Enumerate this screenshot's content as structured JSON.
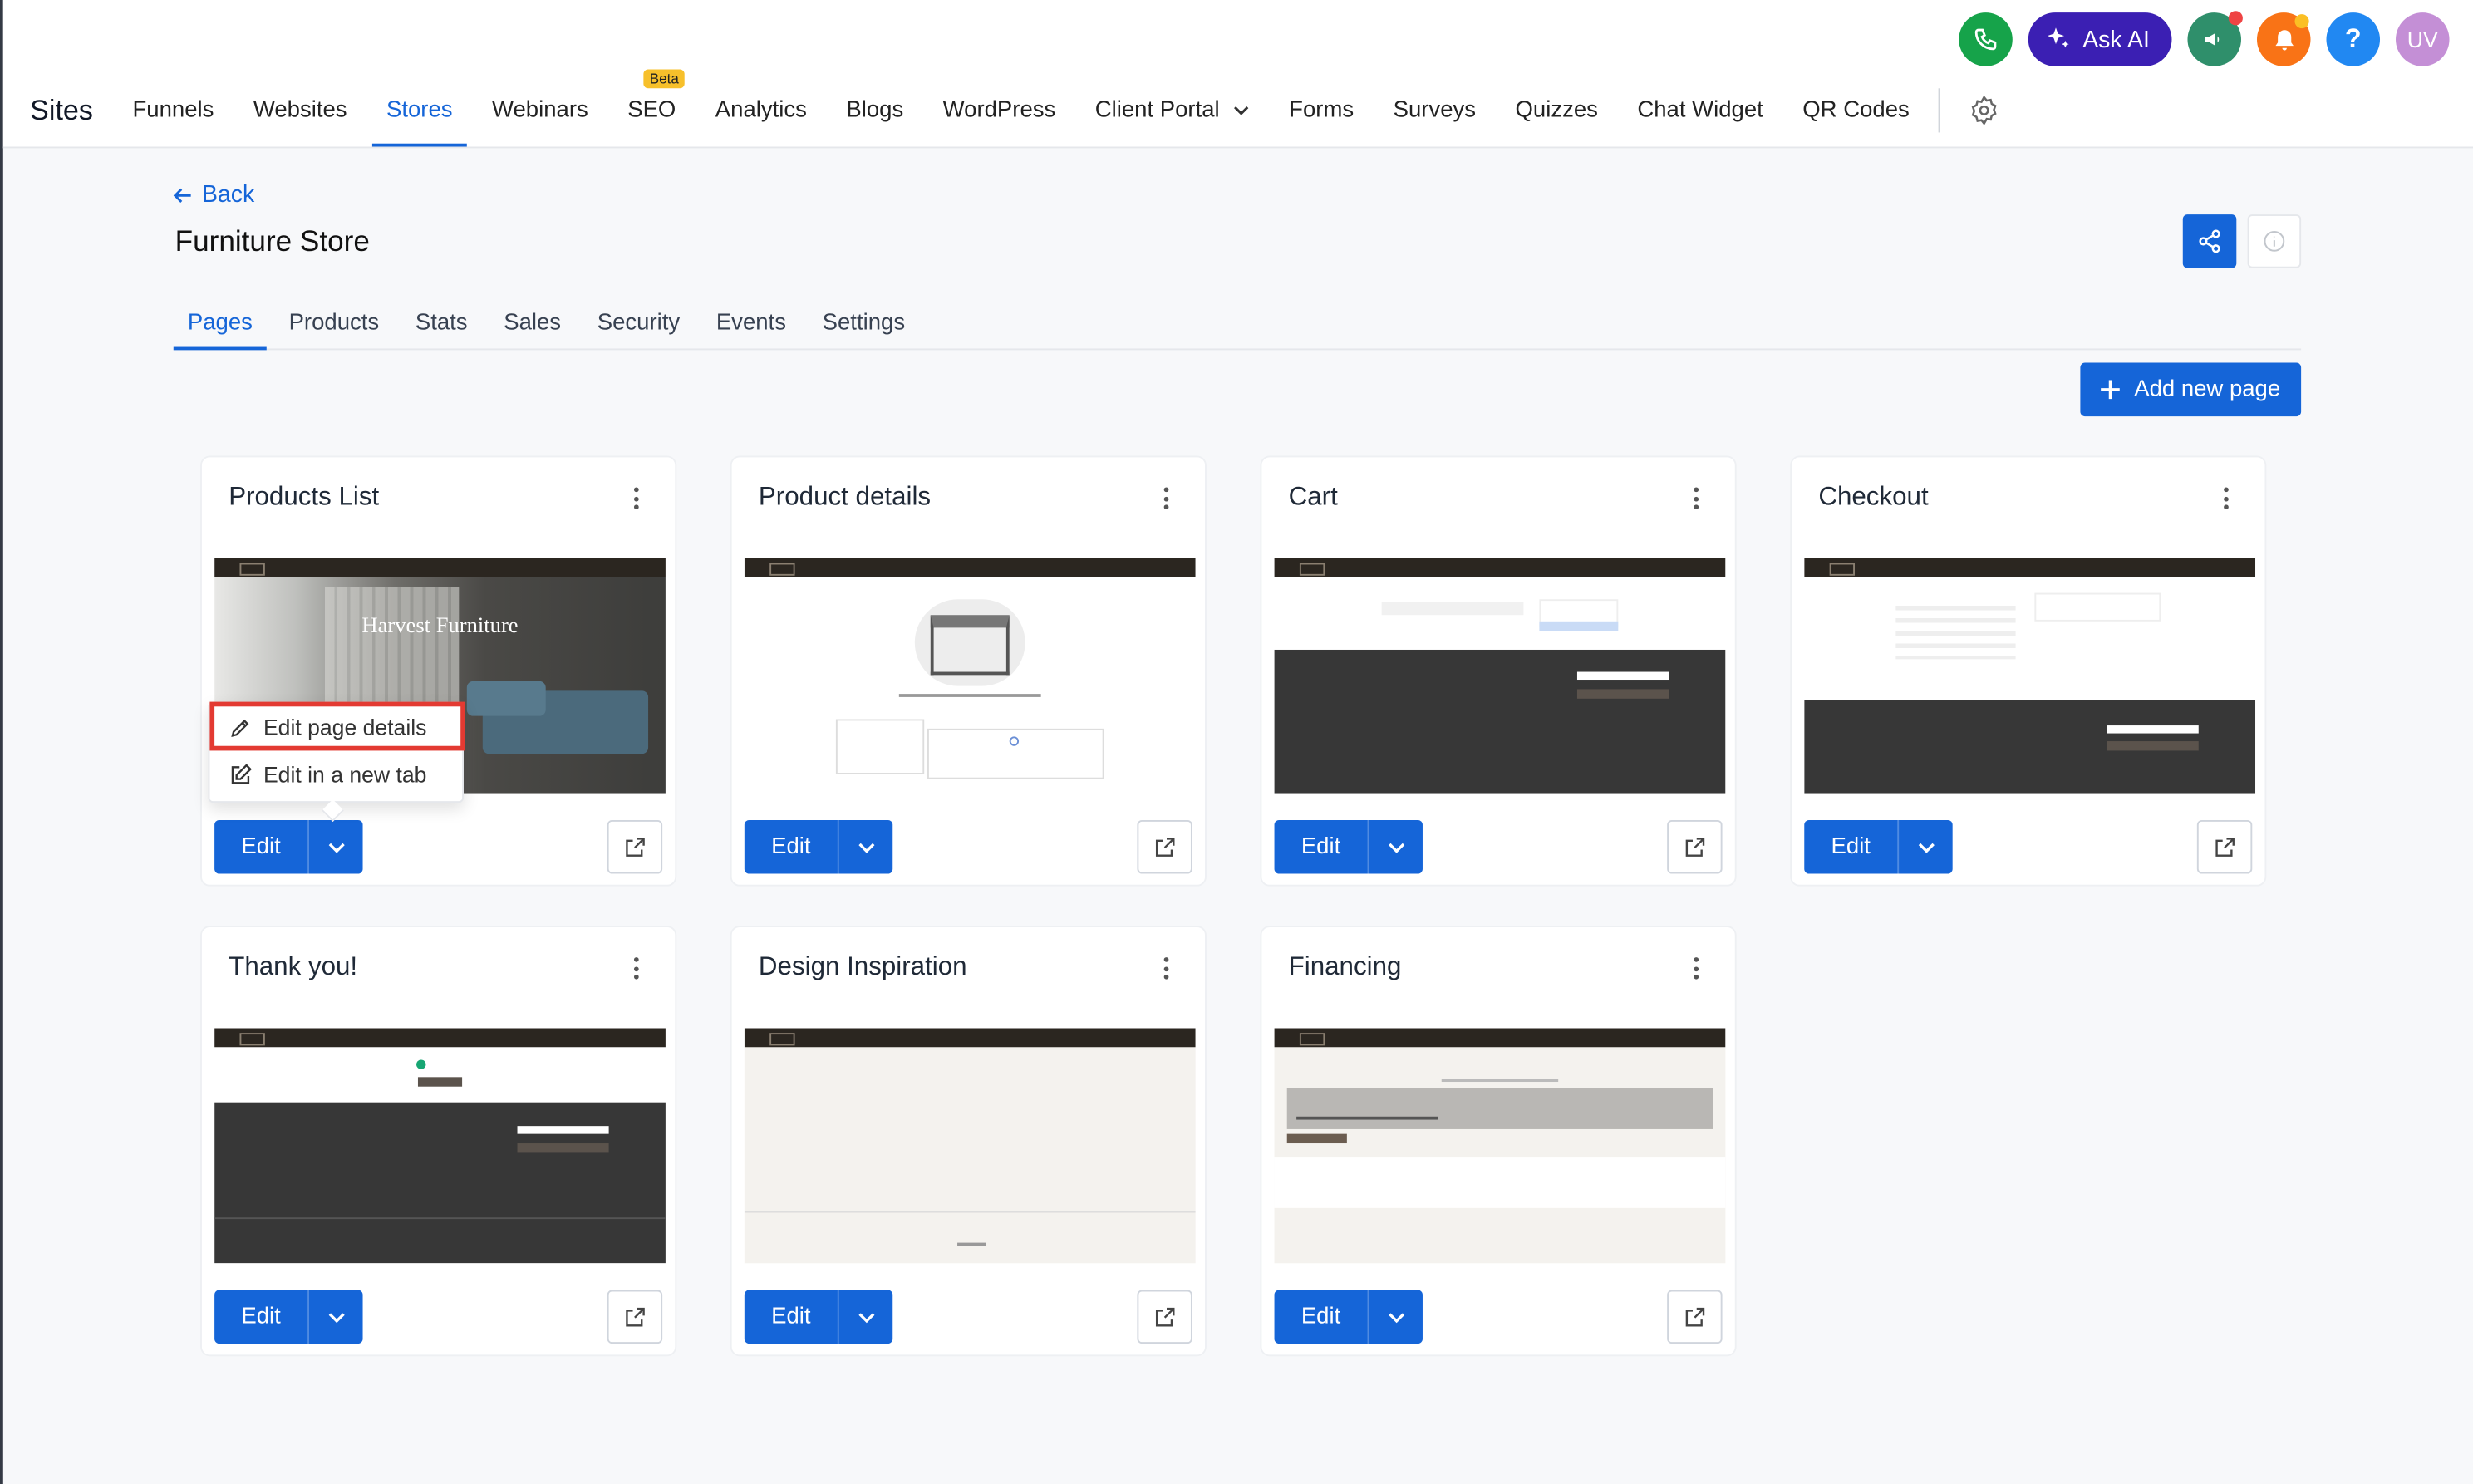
{
  "header": {
    "title": "Sites",
    "nav_items": [
      {
        "label": "Funnels"
      },
      {
        "label": "Websites"
      },
      {
        "label": "Stores",
        "active": true
      },
      {
        "label": "Webinars"
      },
      {
        "label": "SEO",
        "badge": "Beta"
      },
      {
        "label": "Analytics"
      },
      {
        "label": "Blogs"
      },
      {
        "label": "WordPress"
      },
      {
        "label": "Client Portal"
      },
      {
        "label": "Forms"
      },
      {
        "label": "Surveys"
      },
      {
        "label": "Quizzes"
      },
      {
        "label": "Chat Widget"
      },
      {
        "label": "QR Codes"
      }
    ],
    "ask_ai_label": "Ask AI",
    "help_label": "?",
    "avatar_initials": "UV"
  },
  "page": {
    "back_label": "Back",
    "title": "Furniture Store",
    "tabs": [
      "Pages",
      "Products",
      "Stats",
      "Sales",
      "Security",
      "Events",
      "Settings"
    ],
    "active_tab": "Pages",
    "add_page_label": "Add new page"
  },
  "cards": [
    {
      "title": "Products List",
      "thumb_text": "Harvest Furniture",
      "edit_label": "Edit"
    },
    {
      "title": "Product details",
      "edit_label": "Edit"
    },
    {
      "title": "Cart",
      "edit_label": "Edit"
    },
    {
      "title": "Checkout",
      "edit_label": "Edit"
    },
    {
      "title": "Thank you!",
      "edit_label": "Edit"
    },
    {
      "title": "Design Inspiration",
      "edit_label": "Edit"
    },
    {
      "title": "Financing",
      "edit_label": "Edit"
    }
  ],
  "dropdown": {
    "items": [
      "Edit page details",
      "Edit in a new tab"
    ]
  },
  "colors": {
    "primary": "#1565d8",
    "highlight": "#e33a32",
    "ask_ai": "#3b1fb3",
    "beta_badge": "#f7c02b"
  }
}
